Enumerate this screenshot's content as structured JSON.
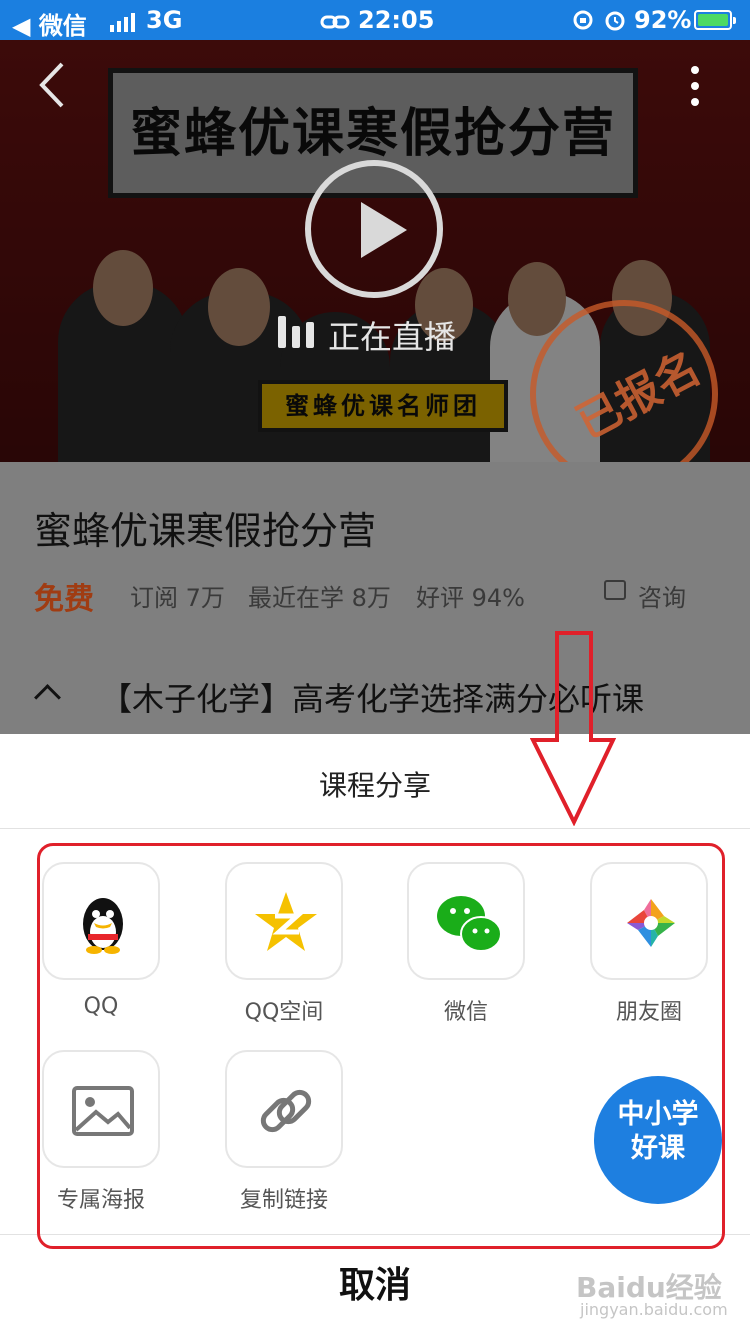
{
  "status_bar": {
    "back_app": "◀ 微信",
    "network": "3G",
    "time": "22:05",
    "battery_percent": "92%"
  },
  "banner": {
    "board_title": "蜜蜂优课寒假抢分营",
    "team_label": "蜜蜂优课名师团",
    "live_text": "正在直播",
    "stamp_text": "已报名"
  },
  "course": {
    "title": "蜜蜂优课寒假抢分营",
    "price": "免费",
    "subscribe": "订阅 7万",
    "recent": "最近在学 8万",
    "rating": "好评 94%",
    "consult": "咨询",
    "chapter": "【木子化学】高考化学选择满分必听课"
  },
  "share_sheet": {
    "title": "课程分享",
    "items": [
      {
        "label": "QQ",
        "icon": "qq-icon"
      },
      {
        "label": "QQ空间",
        "icon": "qzone-icon"
      },
      {
        "label": "微信",
        "icon": "wechat-icon"
      },
      {
        "label": "朋友圈",
        "icon": "moments-icon"
      },
      {
        "label": "专属海报",
        "icon": "image-icon"
      },
      {
        "label": "复制链接",
        "icon": "link-icon"
      }
    ],
    "cancel": "取消"
  },
  "badge": {
    "line1": "中小学",
    "line2": "好课"
  },
  "watermark": {
    "main": "Baidu经验",
    "sub": "jingyan.baidu.com"
  },
  "colors": {
    "status_bar": "#1b7fe0",
    "price": "#a03c12",
    "annotation_red": "#e0202a"
  }
}
